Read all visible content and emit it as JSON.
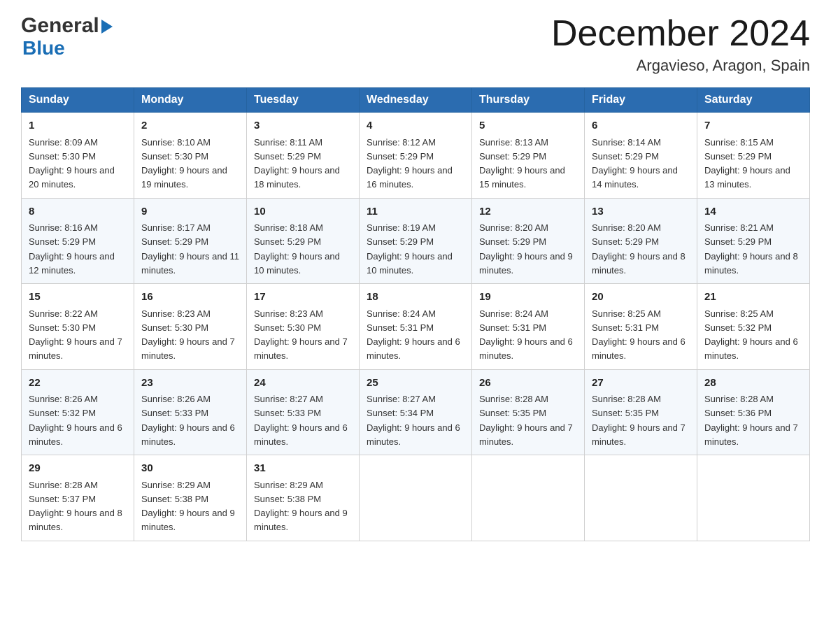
{
  "header": {
    "logo_name": "General",
    "logo_name2": "Blue",
    "month_title": "December 2024",
    "location": "Argavieso, Aragon, Spain"
  },
  "days_of_week": [
    "Sunday",
    "Monday",
    "Tuesday",
    "Wednesday",
    "Thursday",
    "Friday",
    "Saturday"
  ],
  "weeks": [
    [
      {
        "day": "1",
        "sunrise": "8:09 AM",
        "sunset": "5:30 PM",
        "daylight": "9 hours and 20 minutes."
      },
      {
        "day": "2",
        "sunrise": "8:10 AM",
        "sunset": "5:30 PM",
        "daylight": "9 hours and 19 minutes."
      },
      {
        "day": "3",
        "sunrise": "8:11 AM",
        "sunset": "5:29 PM",
        "daylight": "9 hours and 18 minutes."
      },
      {
        "day": "4",
        "sunrise": "8:12 AM",
        "sunset": "5:29 PM",
        "daylight": "9 hours and 16 minutes."
      },
      {
        "day": "5",
        "sunrise": "8:13 AM",
        "sunset": "5:29 PM",
        "daylight": "9 hours and 15 minutes."
      },
      {
        "day": "6",
        "sunrise": "8:14 AM",
        "sunset": "5:29 PM",
        "daylight": "9 hours and 14 minutes."
      },
      {
        "day": "7",
        "sunrise": "8:15 AM",
        "sunset": "5:29 PM",
        "daylight": "9 hours and 13 minutes."
      }
    ],
    [
      {
        "day": "8",
        "sunrise": "8:16 AM",
        "sunset": "5:29 PM",
        "daylight": "9 hours and 12 minutes."
      },
      {
        "day": "9",
        "sunrise": "8:17 AM",
        "sunset": "5:29 PM",
        "daylight": "9 hours and 11 minutes."
      },
      {
        "day": "10",
        "sunrise": "8:18 AM",
        "sunset": "5:29 PM",
        "daylight": "9 hours and 10 minutes."
      },
      {
        "day": "11",
        "sunrise": "8:19 AM",
        "sunset": "5:29 PM",
        "daylight": "9 hours and 10 minutes."
      },
      {
        "day": "12",
        "sunrise": "8:20 AM",
        "sunset": "5:29 PM",
        "daylight": "9 hours and 9 minutes."
      },
      {
        "day": "13",
        "sunrise": "8:20 AM",
        "sunset": "5:29 PM",
        "daylight": "9 hours and 8 minutes."
      },
      {
        "day": "14",
        "sunrise": "8:21 AM",
        "sunset": "5:29 PM",
        "daylight": "9 hours and 8 minutes."
      }
    ],
    [
      {
        "day": "15",
        "sunrise": "8:22 AM",
        "sunset": "5:30 PM",
        "daylight": "9 hours and 7 minutes."
      },
      {
        "day": "16",
        "sunrise": "8:23 AM",
        "sunset": "5:30 PM",
        "daylight": "9 hours and 7 minutes."
      },
      {
        "day": "17",
        "sunrise": "8:23 AM",
        "sunset": "5:30 PM",
        "daylight": "9 hours and 7 minutes."
      },
      {
        "day": "18",
        "sunrise": "8:24 AM",
        "sunset": "5:31 PM",
        "daylight": "9 hours and 6 minutes."
      },
      {
        "day": "19",
        "sunrise": "8:24 AM",
        "sunset": "5:31 PM",
        "daylight": "9 hours and 6 minutes."
      },
      {
        "day": "20",
        "sunrise": "8:25 AM",
        "sunset": "5:31 PM",
        "daylight": "9 hours and 6 minutes."
      },
      {
        "day": "21",
        "sunrise": "8:25 AM",
        "sunset": "5:32 PM",
        "daylight": "9 hours and 6 minutes."
      }
    ],
    [
      {
        "day": "22",
        "sunrise": "8:26 AM",
        "sunset": "5:32 PM",
        "daylight": "9 hours and 6 minutes."
      },
      {
        "day": "23",
        "sunrise": "8:26 AM",
        "sunset": "5:33 PM",
        "daylight": "9 hours and 6 minutes."
      },
      {
        "day": "24",
        "sunrise": "8:27 AM",
        "sunset": "5:33 PM",
        "daylight": "9 hours and 6 minutes."
      },
      {
        "day": "25",
        "sunrise": "8:27 AM",
        "sunset": "5:34 PM",
        "daylight": "9 hours and 6 minutes."
      },
      {
        "day": "26",
        "sunrise": "8:28 AM",
        "sunset": "5:35 PM",
        "daylight": "9 hours and 7 minutes."
      },
      {
        "day": "27",
        "sunrise": "8:28 AM",
        "sunset": "5:35 PM",
        "daylight": "9 hours and 7 minutes."
      },
      {
        "day": "28",
        "sunrise": "8:28 AM",
        "sunset": "5:36 PM",
        "daylight": "9 hours and 7 minutes."
      }
    ],
    [
      {
        "day": "29",
        "sunrise": "8:28 AM",
        "sunset": "5:37 PM",
        "daylight": "9 hours and 8 minutes."
      },
      {
        "day": "30",
        "sunrise": "8:29 AM",
        "sunset": "5:38 PM",
        "daylight": "9 hours and 9 minutes."
      },
      {
        "day": "31",
        "sunrise": "8:29 AM",
        "sunset": "5:38 PM",
        "daylight": "9 hours and 9 minutes."
      },
      null,
      null,
      null,
      null
    ]
  ]
}
